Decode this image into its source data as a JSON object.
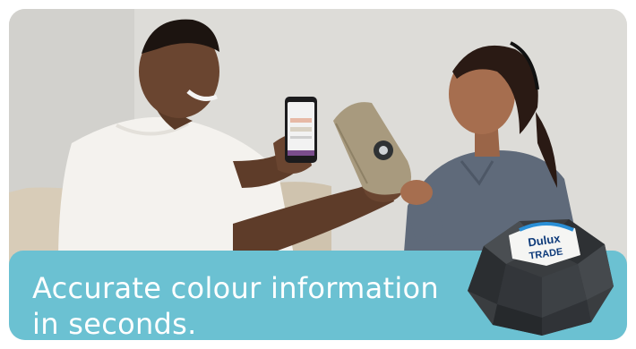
{
  "banner": {
    "headline_line1": "Accurate colour information",
    "headline_line2": "in seconds."
  },
  "device": {
    "brand_top": "Dulux",
    "brand_bottom": "TRADE"
  },
  "colors": {
    "banner": "#6bc1d2",
    "background": "#dcdcda",
    "shirt_man": "#f4f2ee",
    "shirt_woman": "#5f6a7a",
    "sample": "#a89a7e",
    "device_body": "#3a3d40"
  },
  "icons": [
    "dulux-logo-icon",
    "phone-icon",
    "colour-sensor-icon"
  ]
}
